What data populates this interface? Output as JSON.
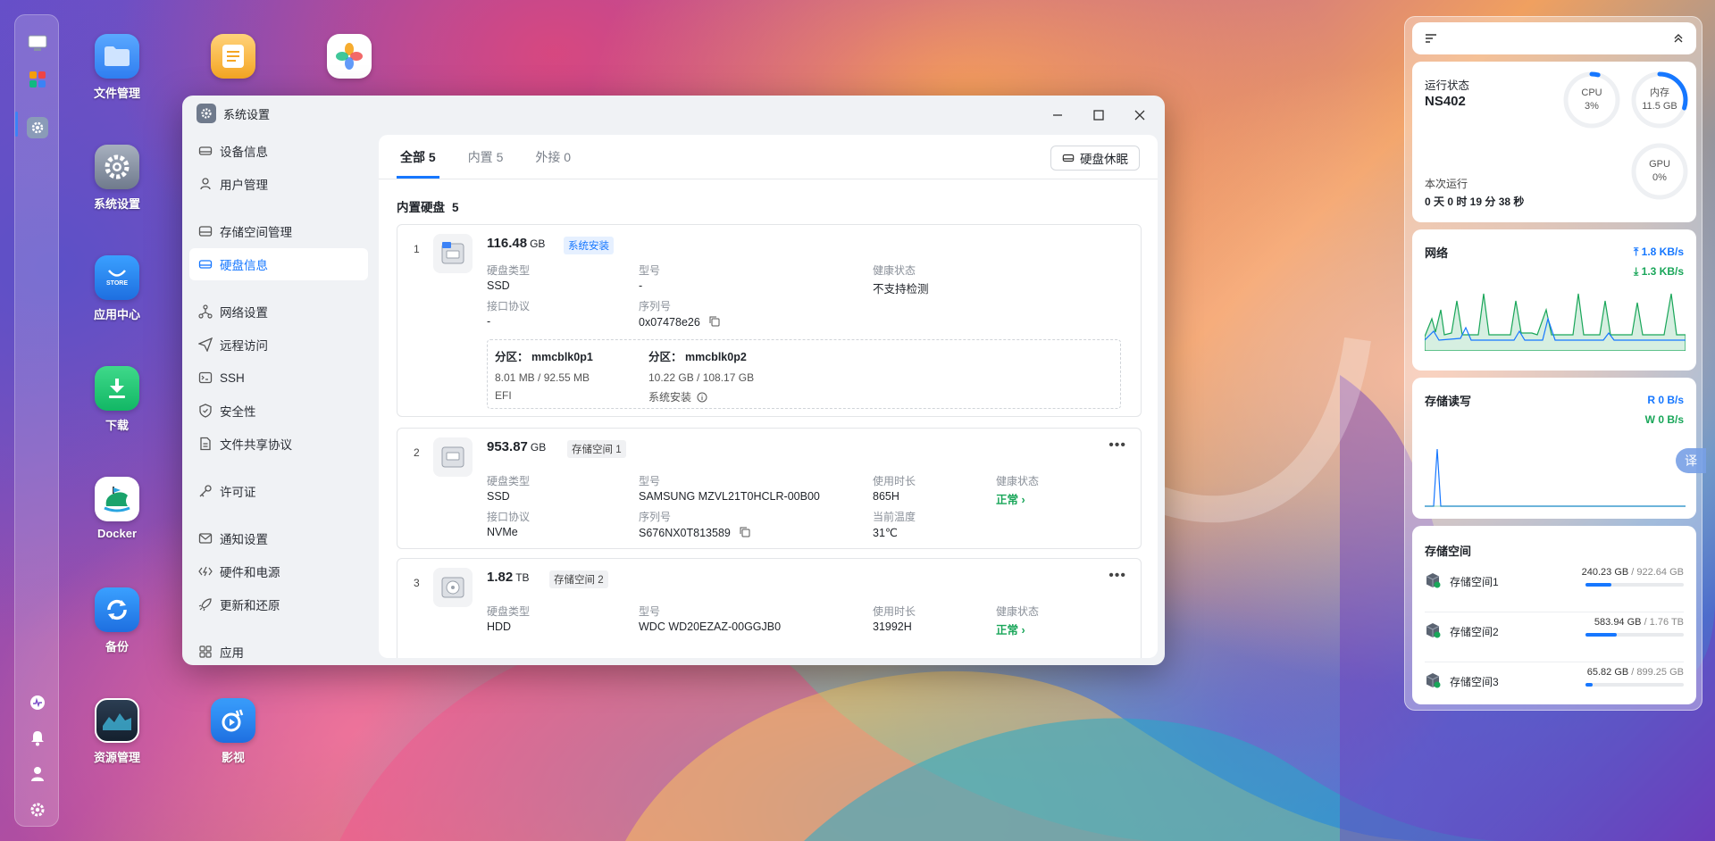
{
  "desktop": {
    "icons": [
      {
        "label": "文件管理",
        "icon": "folder-icon"
      },
      {
        "label": "",
        "icon": "notes-icon"
      },
      {
        "label": "",
        "icon": "photos-icon"
      },
      {
        "label": "系统设置",
        "icon": "gear-icon"
      },
      {
        "label": "应用中心",
        "icon": "store-icon",
        "tile_text": "STORE"
      },
      {
        "label": "下载",
        "icon": "download-icon"
      },
      {
        "label": "Docker",
        "icon": "docker-icon"
      },
      {
        "label": "备份",
        "icon": "backup-icon"
      },
      {
        "label": "资源管理",
        "icon": "monitor-icon"
      },
      {
        "label": "影视",
        "icon": "video-icon"
      }
    ]
  },
  "window": {
    "title": "系统设置",
    "sidebar": [
      {
        "label": "设备信息",
        "icon": "drive-icon"
      },
      {
        "label": "用户管理",
        "icon": "user-icon"
      },
      {
        "label": "存储空间管理",
        "icon": "storage-icon"
      },
      {
        "label": "硬盘信息",
        "icon": "disk-icon",
        "active": true
      },
      {
        "label": "网络设置",
        "icon": "network-icon"
      },
      {
        "label": "远程访问",
        "icon": "send-icon"
      },
      {
        "label": "SSH",
        "icon": "terminal-icon"
      },
      {
        "label": "安全性",
        "icon": "shield-icon"
      },
      {
        "label": "文件共享协议",
        "icon": "file-icon"
      },
      {
        "label": "许可证",
        "icon": "key-icon"
      },
      {
        "label": "通知设置",
        "icon": "mail-icon"
      },
      {
        "label": "硬件和电源",
        "icon": "power-icon"
      },
      {
        "label": "更新和还原",
        "icon": "rocket-icon"
      },
      {
        "label": "应用",
        "icon": "apps-icon"
      }
    ],
    "tabs": [
      {
        "label": "全部",
        "count": "5"
      },
      {
        "label": "内置",
        "count": "5"
      },
      {
        "label": "外接",
        "count": "0"
      }
    ],
    "sleep_button": "硬盘休眠",
    "section": {
      "title": "内置硬盘",
      "count": "5"
    },
    "disks": [
      {
        "index": "1",
        "size": "116.48",
        "unit": "GB",
        "badge": "系统安装",
        "type_label": "硬盘类型",
        "type": "SSD",
        "model_label": "型号",
        "model": "-",
        "health_label": "健康状态",
        "health": "不支持检测",
        "iface_label": "接口协议",
        "iface": "-",
        "serial_label": "序列号",
        "serial": "0x07478e26",
        "partitions": [
          {
            "name_label": "分区：",
            "name": "mmcblk0p1",
            "usage": "8.01 MB / 92.55 MB",
            "fs": "EFI"
          },
          {
            "name_label": "分区：",
            "name": "mmcblk0p2",
            "usage": "10.22 GB / 108.17 GB",
            "fs": "系统安装"
          }
        ]
      },
      {
        "index": "2",
        "size": "953.87",
        "unit": "GB",
        "badge": "存储空间 1",
        "type_label": "硬盘类型",
        "type": "SSD",
        "model_label": "型号",
        "model": "SAMSUNG MZVL21T0HCLR-00B00",
        "uptime_label": "使用时长",
        "uptime": "865H",
        "health_label": "健康状态",
        "health": "正常",
        "iface_label": "接口协议",
        "iface": "NVMe",
        "serial_label": "序列号",
        "serial": "S676NX0T813589",
        "temp_label": "当前温度",
        "temp": "31℃"
      },
      {
        "index": "3",
        "size": "1.82",
        "unit": "TB",
        "badge": "存储空间 2",
        "type_label": "硬盘类型",
        "type": "HDD",
        "model_label": "型号",
        "model": "WDC WD20EZAZ-00GGJB0",
        "uptime_label": "使用时长",
        "uptime": "31992H",
        "health_label": "健康状态",
        "health": "正常"
      }
    ]
  },
  "widgets": {
    "status": {
      "title": "运行状态",
      "device": "NS402",
      "cpu_label": "CPU",
      "cpu": "3%",
      "cpu_fraction": 0.03,
      "mem_label": "内存",
      "mem": "11.5 GB",
      "mem_fraction": 0.3,
      "gpu_label": "GPU",
      "gpu": "0%",
      "gpu_fraction": 0,
      "uptime_label": "本次运行",
      "uptime": "0 天 0 时 19 分 38 秒"
    },
    "network": {
      "title": "网络",
      "up": "1.8 KB/s",
      "down": "1.3 KB/s"
    },
    "disk_io": {
      "title": "存储读写",
      "read": "R  0 B/s",
      "write": "W  0 B/s"
    },
    "storage": {
      "title": "存储空间",
      "pools": [
        {
          "name": "存储空间1",
          "used": "240.23 GB",
          "total": "/ 922.64 GB",
          "fraction": 0.26
        },
        {
          "name": "存储空间2",
          "used": "583.94 GB",
          "total": "/ 1.76 TB",
          "fraction": 0.32
        },
        {
          "name": "存储空间3",
          "used": "65.82 GB",
          "total": "/ 899.25 GB",
          "fraction": 0.07
        }
      ]
    }
  },
  "translate_label": "译",
  "colors": {
    "accent": "#1677ff",
    "ok": "#19a659"
  }
}
